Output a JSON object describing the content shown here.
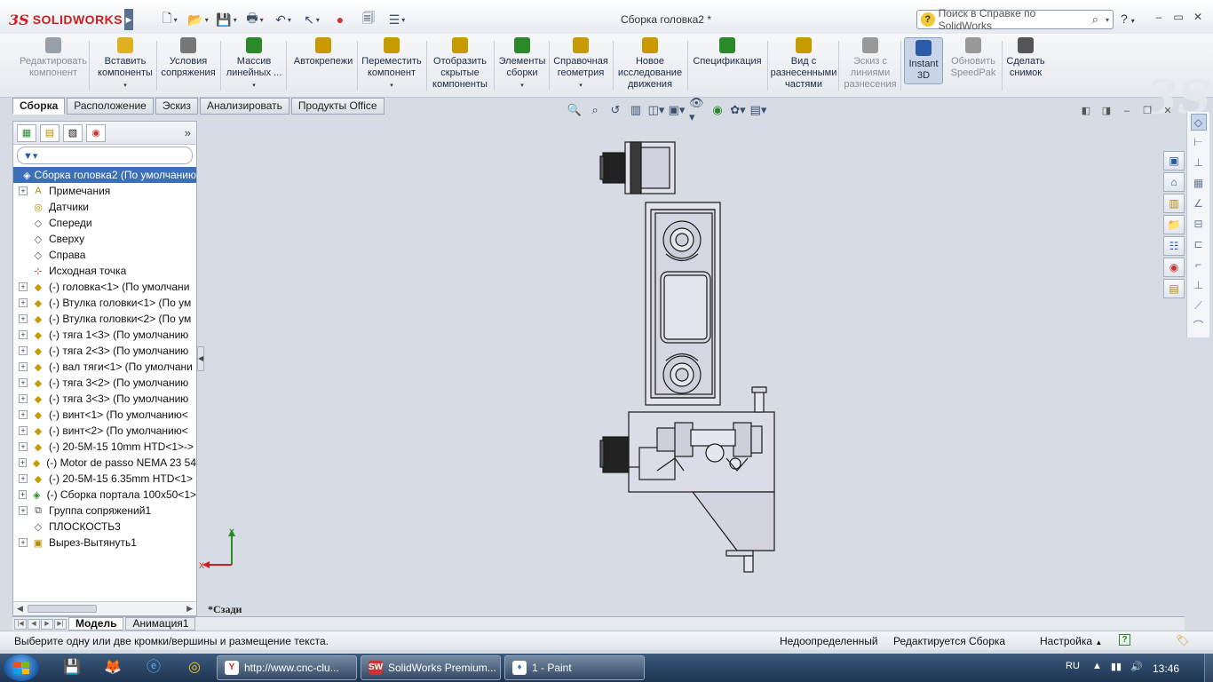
{
  "app": {
    "logo_text": "SOLIDWORKS",
    "document_title": "Сборка головка2 *",
    "help_search_placeholder": "Поиск в Справке по SolidWorks"
  },
  "command_manager": [
    {
      "label": "Редактировать компонент",
      "disabled": true
    },
    {
      "label": "Вставить компоненты",
      "dropdown": true
    },
    {
      "label": "Условия сопряжения"
    },
    {
      "label": "Массив линейных ...",
      "dropdown": true
    },
    {
      "label": "Автокрепежи"
    },
    {
      "label": "Переместить компонент",
      "dropdown": true
    },
    {
      "label": "Отобразить скрытые компоненты"
    },
    {
      "label": "Элементы сборки",
      "dropdown": true
    },
    {
      "label": "Справочная геометрия",
      "dropdown": true
    },
    {
      "label": "Новое исследование движения"
    },
    {
      "label": "Спецификация"
    },
    {
      "label": "Вид с разнесенными частями"
    },
    {
      "label": "Эскиз с линиями разнесения",
      "disabled": true
    },
    {
      "label": "Instant 3D",
      "active": true
    },
    {
      "label": "Обновить SpeedPak",
      "disabled": true
    },
    {
      "label": "Сделать снимок"
    }
  ],
  "tabs": [
    "Сборка",
    "Расположение",
    "Эскиз",
    "Анализировать",
    "Продукты Office"
  ],
  "active_tab": "Сборка",
  "feature_tree": {
    "root": "Сборка головка2  (По умолчанию",
    "items": [
      {
        "label": "Примечания",
        "icon": "annotation-icon",
        "expandable": true
      },
      {
        "label": "Датчики",
        "icon": "sensor-icon",
        "expandable": false
      },
      {
        "label": "Спереди",
        "icon": "plane-icon",
        "expandable": false
      },
      {
        "label": "Сверху",
        "icon": "plane-icon",
        "expandable": false
      },
      {
        "label": "Справа",
        "icon": "plane-icon",
        "expandable": false
      },
      {
        "label": "Исходная точка",
        "icon": "origin-icon",
        "expandable": false
      },
      {
        "label": "(-) головка<1> (По умолчани",
        "icon": "part-icon",
        "expandable": true
      },
      {
        "label": "(-) Втулка головки<1> (По ум",
        "icon": "part-icon",
        "expandable": true
      },
      {
        "label": "(-) Втулка головки<2> (По ум",
        "icon": "part-icon",
        "expandable": true
      },
      {
        "label": "(-) тяга 1<3> (По умолчанию",
        "icon": "part-icon",
        "expandable": true
      },
      {
        "label": "(-) тяга 2<3> (По умолчанию",
        "icon": "part-icon",
        "expandable": true
      },
      {
        "label": "(-) вал тяги<1> (По умолчани",
        "icon": "part-icon",
        "expandable": true
      },
      {
        "label": "(-) тяга 3<2> (По умолчанию",
        "icon": "part-icon",
        "expandable": true
      },
      {
        "label": "(-) тяга 3<3> (По умолчанию",
        "icon": "part-icon",
        "expandable": true
      },
      {
        "label": "(-) винт<1> (По умолчанию<",
        "icon": "part-icon",
        "expandable": true
      },
      {
        "label": "(-) винт<2> (По умолчанию<",
        "icon": "part-icon",
        "expandable": true
      },
      {
        "label": "(-) 20-5M-15 10mm HTD<1>->",
        "icon": "part-icon",
        "expandable": true
      },
      {
        "label": "(-) Motor de passo NEMA 23 54",
        "icon": "part-icon",
        "expandable": true
      },
      {
        "label": "(-) 20-5M-15 6.35mm HTD<1>",
        "icon": "part-icon",
        "expandable": true
      },
      {
        "label": "(-) Сборка портала 100x50<1>",
        "icon": "subassembly-icon",
        "expandable": true
      },
      {
        "label": "Группа сопряжений1",
        "icon": "mate-group-icon",
        "expandable": true
      },
      {
        "label": "ПЛОСКОСТЬ3",
        "icon": "plane-icon",
        "expandable": false
      },
      {
        "label": "Вырез-Вытянуть1",
        "icon": "cut-extrude-icon",
        "expandable": true
      }
    ]
  },
  "viewport": {
    "view_orientation": "*Сзади",
    "triad": {
      "x": "X",
      "y": "Y"
    }
  },
  "model_tabs": [
    "Модель",
    "Анимация1"
  ],
  "active_model_tab": "Модель",
  "status_bar": {
    "message": "Выберите одну или две кромки/вершины и размещение текста.",
    "definition": "Недоопределенный",
    "editing": "Редактируется Сборка",
    "settings": "Настройка"
  },
  "taskbar": {
    "tasks": [
      {
        "label": "http://www.cnc-clu...",
        "icon": "yandex-browser-icon"
      },
      {
        "label": "SolidWorks Premium...",
        "icon": "solidworks-icon"
      },
      {
        "label": "1 - Paint",
        "icon": "paint-icon"
      }
    ],
    "language": "RU",
    "time": "13:46"
  },
  "colors": {
    "viewport_bg": "#d6dbe4",
    "model_fill": "#d9d9e6",
    "model_edge": "#1a1a1a",
    "selection_blue": "#3b6fb6",
    "brand_red": "#cc1f1f"
  }
}
